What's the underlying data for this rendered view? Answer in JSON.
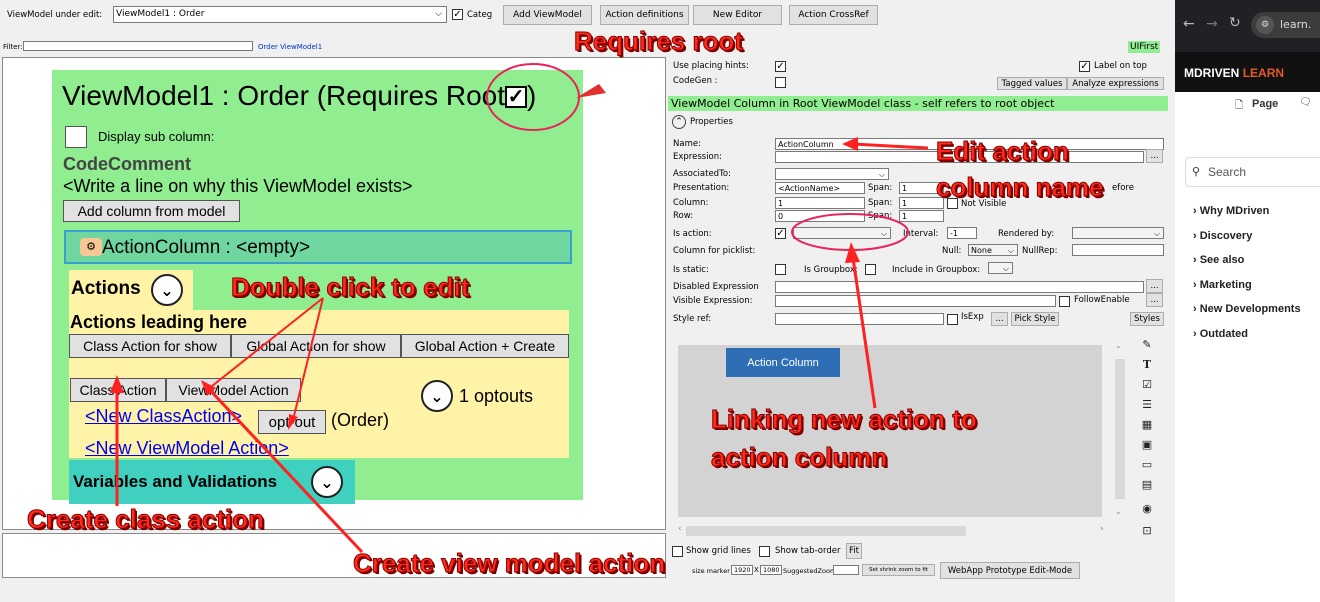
{
  "toolbar": {
    "vm_label": "ViewModel under edit:",
    "vm_value": "ViewModel1 : Order",
    "categ_label": "Categ",
    "add_vm": "Add ViewModel",
    "action_defs": "Action definitions",
    "new_editor": "New Editor",
    "action_crossref": "Action CrossRef"
  },
  "filter": {
    "label": "Filter:",
    "crumb": "Order ViewModel1",
    "uifirst": "UIFirst"
  },
  "canvas": {
    "title": "ViewModel1 : Order  (Requires Root",
    "title_close": ")",
    "display_sub": "Display sub column:",
    "codecomment": "CodeComment",
    "write_line": "<Write a line on why this ViewModel exists>",
    "add_col": "Add column from model",
    "action_column": "ActionColumn : <empty>",
    "actions": "Actions",
    "actions_leading": "Actions leading here",
    "class_action_show": "Class Action for show",
    "global_action_show": "Global Action for show",
    "global_action_create": "Global Action + Create",
    "class_action": "Class Action",
    "vm_action": "ViewModel Action",
    "optouts": "1 optouts",
    "new_class_action": "<New ClassAction>",
    "opt_out": "opt-out",
    "order": "(Order)",
    "new_vm_action": "<New ViewModel Action>",
    "vars": "Variables and Validations"
  },
  "props": {
    "placing_hints": "Use placing hints:",
    "codegen": "CodeGen :",
    "label_on_top": "Label on top",
    "tagged": "Tagged values",
    "analyze": "Analyze expressions",
    "banner": "ViewModel Column in Root ViewModel class - self refers to root object",
    "properties": "Properties",
    "name_lbl": "Name:",
    "name_val": "ActionColumn",
    "expr_lbl": "Expression:",
    "assoc_lbl": "AssociatedTo:",
    "pres_lbl": "Presentation:",
    "pres_val": "<ActionName>",
    "span": "Span:",
    "span_val": "1",
    "efore": "efore",
    "col_lbl": "Column:",
    "col_val": "1",
    "not_visible": "Not Visible",
    "row_lbl": "Row:",
    "row_val": "0",
    "isaction_lbl": "Is action:",
    "interval": "Interval:",
    "interval_val": "-1",
    "rendered_by": "Rendered by:",
    "picklist": "Column for picklist:",
    "null_lbl": "Null:",
    "null_val": "None",
    "nullrep": "NullRep:",
    "isstatic": "Is static:",
    "isgroupbox": "Is Groupbox:",
    "incl_gb": "Include in Groupbox:",
    "disabled_expr": "Disabled Expression",
    "visible_expr": "Visible Expression:",
    "follow_enable": "FollowEnable",
    "style_ref": "Style ref:",
    "isexp": "IsExp",
    "pick_style": "Pick Style",
    "styles": "Styles",
    "ellipsis": "...",
    "preview_btn": "Action Column",
    "show_grid": "Show grid lines",
    "show_tab": "Show tab-order",
    "fit": "Fit",
    "size_marker": "size marker",
    "w": "1920",
    "x": "X",
    "h": "1080",
    "suggested": "SuggestedZoom",
    "shrink": "Set shrink zoom to fit",
    "webapp": "WebApp Prototype Edit-Mode"
  },
  "annotations": {
    "requires_root": "Requires root",
    "edit_action": "Edit action",
    "column_name": "column name",
    "double_click": "Double click to edit",
    "linking": "Linking new action to",
    "action_col": "action column",
    "create_class": "Create class action",
    "create_vm": "Create view model action"
  },
  "browser": {
    "url": "learn.",
    "brand_a": "MDRIVEN",
    "brand_b": "LEARN",
    "page_tab": "Page",
    "search": "Search",
    "nav": [
      "Why MDriven",
      "Discovery",
      "See also",
      "Marketing",
      "New Developments",
      "Outdated"
    ]
  },
  "colors": {
    "green": "#90ee90",
    "yellow": "#fff3a8",
    "teal": "#40d0c0",
    "annotation": "#ff2a1a",
    "preview_btn": "#2e6eb5"
  }
}
